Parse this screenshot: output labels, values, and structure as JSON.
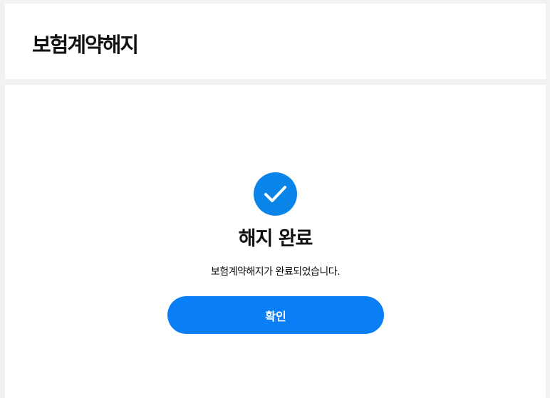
{
  "header": {
    "title": "보험계약해지"
  },
  "result": {
    "icon": "check-circle-icon",
    "title": "해지 완료",
    "message": "보험계약해지가 완료되었습니다.",
    "confirm_label": "확인"
  },
  "colors": {
    "accent": "#0a84e8",
    "button": "#0a7ef5",
    "background": "#f2f2f2"
  }
}
